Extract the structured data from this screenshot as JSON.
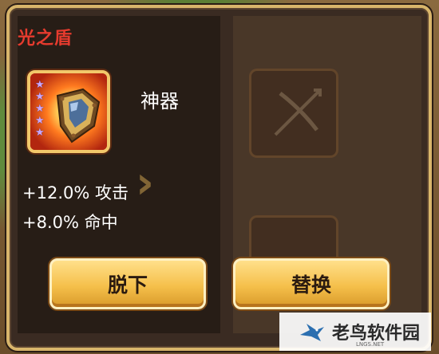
{
  "item": {
    "name": "光之盾",
    "grade": "神器",
    "star_count": 5,
    "icon": "shield-icon"
  },
  "stats": [
    "+12.0% 攻击",
    "+8.0% 命中"
  ],
  "buttons": {
    "unequip_label": "脱下",
    "replace_label": "替换"
  },
  "watermark": {
    "text": "老鸟软件园",
    "sub": "LNGS.NET"
  },
  "colors": {
    "title": "#e63b2e",
    "button": "#f5c04b",
    "frame": "#f2c86a",
    "stars": "#c9a7ff"
  }
}
